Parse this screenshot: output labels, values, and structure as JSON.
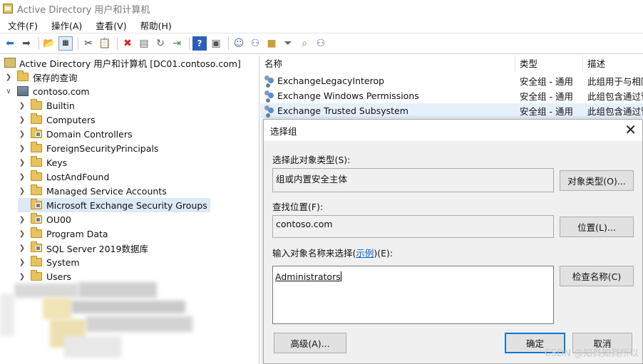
{
  "window": {
    "title": "Active Directory 用户和计算机"
  },
  "menu": [
    "文件(F)",
    "操作(A)",
    "查看(V)",
    "帮助(H)"
  ],
  "toolbar": [
    "back-icon",
    "forward-icon",
    "sep",
    "up-folder-icon",
    "show-tree-icon",
    "sep",
    "cut-icon",
    "copy-icon",
    "sep",
    "delete-icon",
    "properties-icon",
    "refresh-icon",
    "export-icon",
    "sep",
    "help-icon",
    "console-icon",
    "sep",
    "new-user-icon",
    "new-group-icon",
    "new-ou-icon",
    "filter-icon",
    "find-icon",
    "add-to-group-icon"
  ],
  "tree": {
    "root": "Active Directory 用户和计算机 [DC01.contoso.com]",
    "saved_queries": "保存的查询",
    "domain": "contoso.com",
    "items": [
      "Builtin",
      "Computers",
      "Domain Controllers",
      "ForeignSecurityPrincipals",
      "Keys",
      "LostAndFound",
      "Managed Service Accounts",
      "Microsoft Exchange Security Groups",
      "OU00",
      "Program Data",
      "SQL Server 2019数据库",
      "System",
      "Users"
    ]
  },
  "list": {
    "columns": [
      "名称",
      "类型",
      "描述"
    ],
    "rows": [
      {
        "name": "ExchangeLegacyInterop",
        "type": "安全组 - 通用",
        "desc": "此组用于与相同"
      },
      {
        "name": "Exchange Windows Permissions",
        "type": "安全组 - 通用",
        "desc": "此组包含通过管"
      },
      {
        "name": "Exchange Trusted Subsystem",
        "type": "安全组 - 通用",
        "desc": "此组包含通过管"
      }
    ]
  },
  "dialog": {
    "title": "选择组",
    "object_type_label": "选择此对象类型(S):",
    "object_type_value": "组或内置安全主体",
    "object_type_button": "对象类型(O)...",
    "location_label": "查找位置(F):",
    "location_value": "contoso.com",
    "location_button": "位置(L)...",
    "names_label_prefix": "输入对象名称来选择(",
    "names_label_link": "示例",
    "names_label_suffix": ")(E):",
    "names_value": "Administrators",
    "check_names_button": "检查名称(C)",
    "advanced_button": "高级(A)...",
    "ok_button": "确定",
    "cancel_button": "取消"
  },
  "watermark": "CSDN @知其知其所以"
}
